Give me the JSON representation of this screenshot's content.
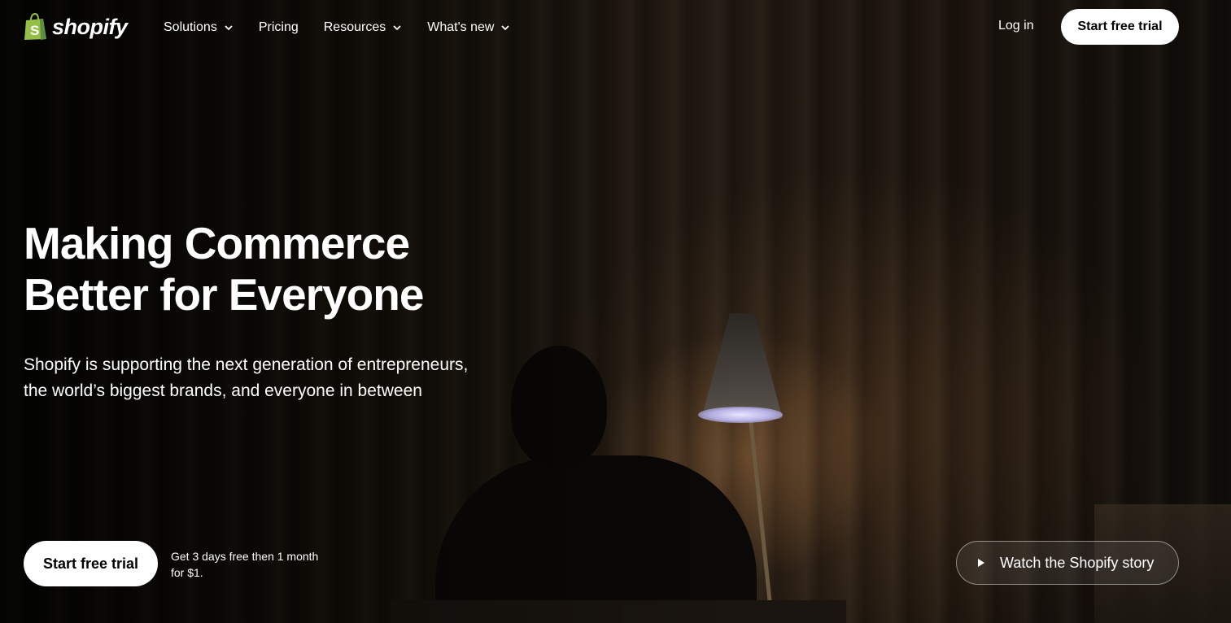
{
  "brand": {
    "name": "shopify",
    "logo_icon": "shopping-bag-icon",
    "logo_color": "#95BF47"
  },
  "nav": {
    "items": [
      {
        "label": "Solutions",
        "has_dropdown": true
      },
      {
        "label": "Pricing",
        "has_dropdown": false
      },
      {
        "label": "Resources",
        "has_dropdown": true
      },
      {
        "label": "What's new",
        "has_dropdown": true
      }
    ],
    "login_label": "Log in",
    "cta_label": "Start free trial"
  },
  "hero": {
    "headline_line1": "Making Commerce",
    "headline_line2": "Better for Everyone",
    "subhead_line1": "Shopify is supporting the next generation of entrepreneurs,",
    "subhead_line2": "the world’s biggest brands, and everyone in between",
    "cta_label": "Start free trial",
    "trial_note": "Get 3 days free then 1 month for $1.",
    "video_label": "Watch the Shopify story",
    "video_icon": "play-icon"
  },
  "colors": {
    "text": "#FFFFFF",
    "button_bg": "#FFFFFF",
    "button_text": "#000000"
  }
}
